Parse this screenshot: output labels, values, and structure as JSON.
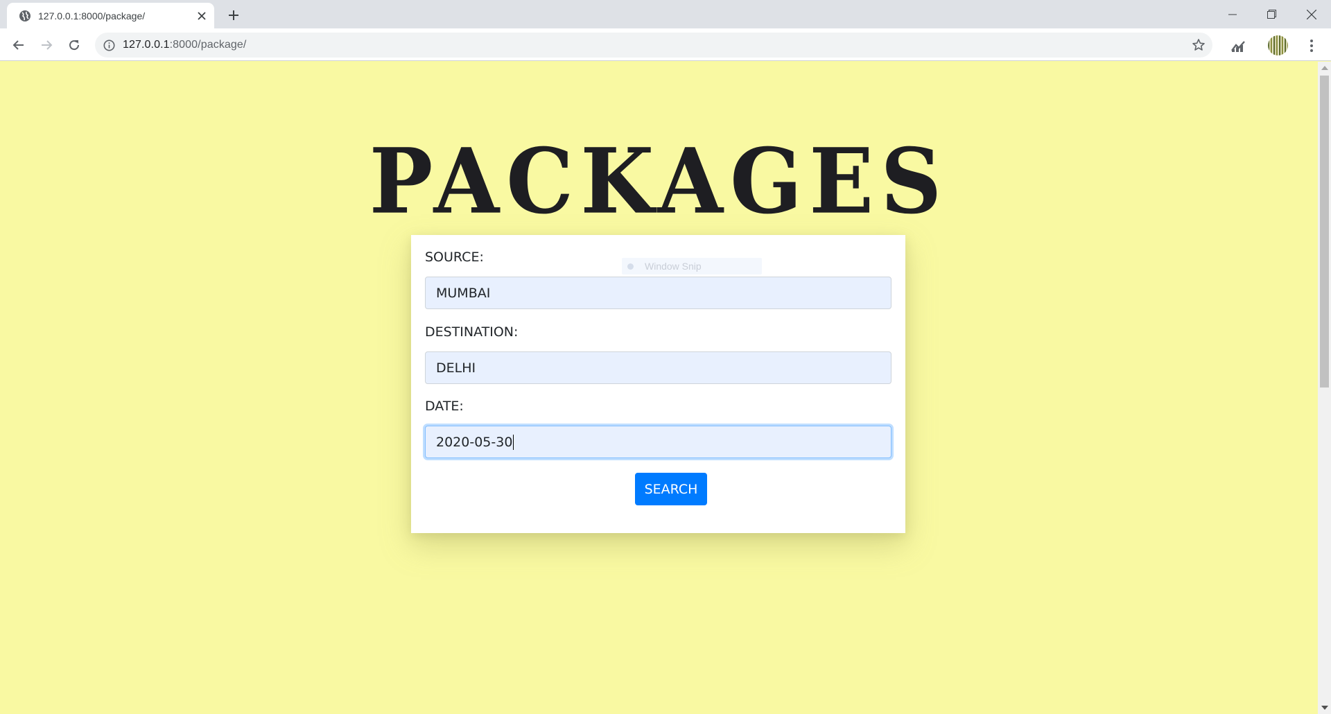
{
  "browser": {
    "tab_title": "127.0.0.1:8000/package/",
    "url_host": "127.0.0.1",
    "url_path": ":8000/package/"
  },
  "page": {
    "title": "PACKAGES",
    "form": {
      "source_label": "SOURCE:",
      "source_value": "MUMBAI",
      "destination_label": "DESTINATION:",
      "destination_value": "DELHI",
      "date_label": "DATE:",
      "date_value": "2020-05-30",
      "search_label": "SEARCH"
    }
  },
  "overlay": {
    "snip_label": "Window Snip"
  },
  "colors": {
    "page_background": "#f9f9a2",
    "button_primary": "#007bff",
    "input_autofill": "#e8f0fe"
  }
}
